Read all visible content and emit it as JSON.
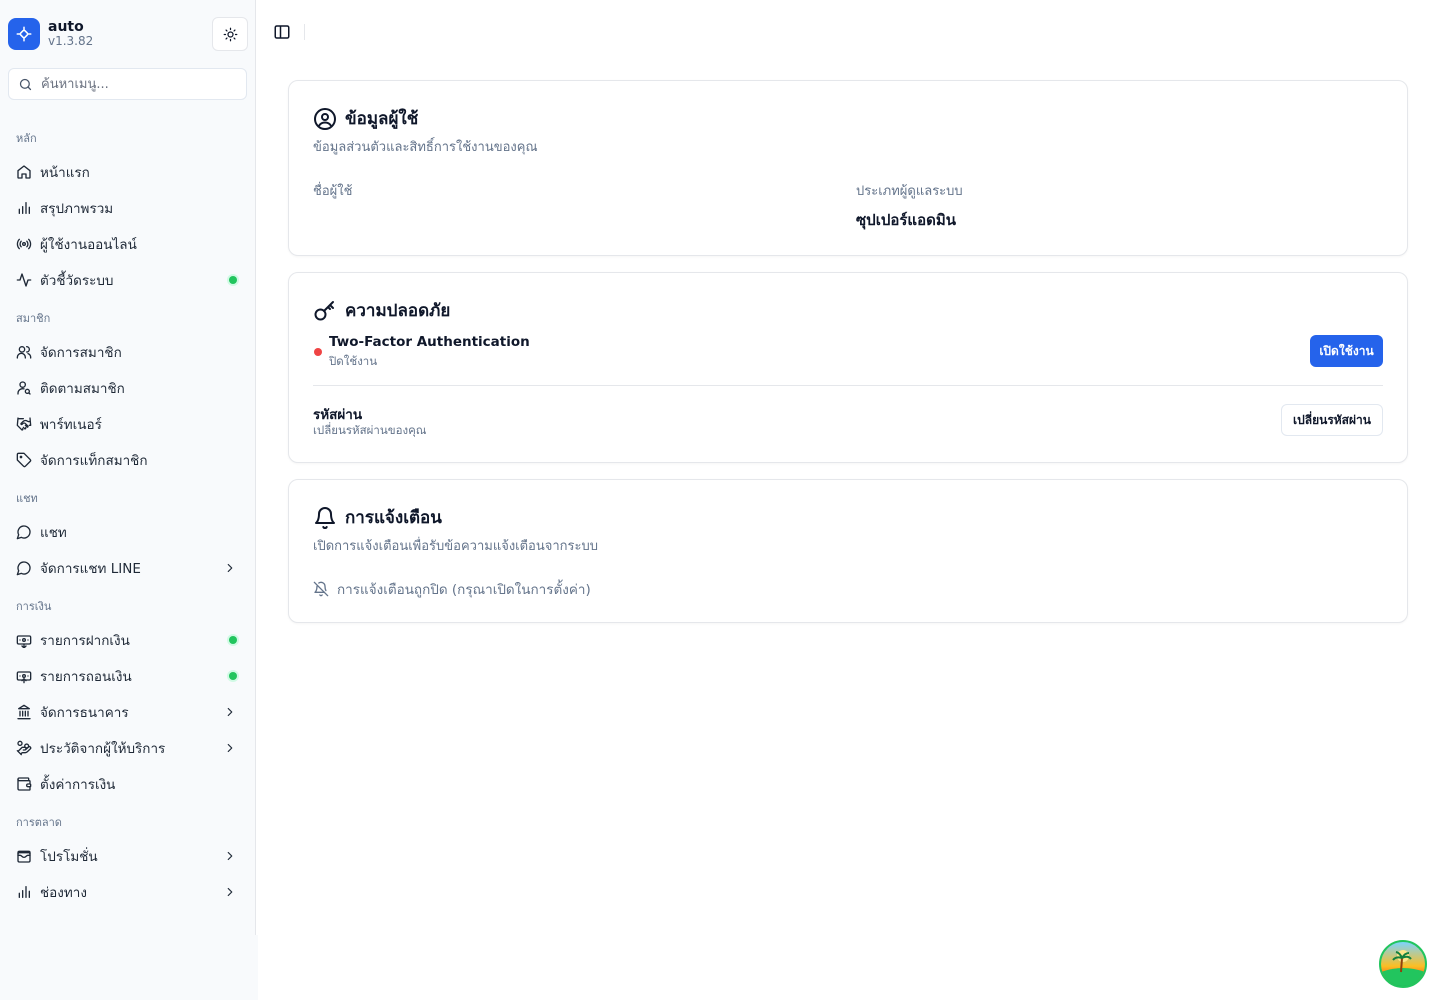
{
  "app": {
    "name": "auto",
    "version": "v1.3.82"
  },
  "search": {
    "placeholder": "ค้นหาเมนู..."
  },
  "sidebar": {
    "groups": [
      {
        "heading": "หลัก",
        "items": [
          {
            "label": "หน้าแรก",
            "icon": "home-icon"
          },
          {
            "label": "สรุปภาพรวม",
            "icon": "bar-chart-icon"
          },
          {
            "label": "ผู้ใช้งานออนไลน์",
            "icon": "broadcast-icon"
          },
          {
            "label": "ตัวชี้วัดระบบ",
            "icon": "activity-icon",
            "status": "online"
          }
        ]
      },
      {
        "heading": "สมาชิก",
        "items": [
          {
            "label": "จัดการสมาชิก",
            "icon": "users-icon"
          },
          {
            "label": "ติดตามสมาชิก",
            "icon": "user-search-icon"
          },
          {
            "label": "พาร์ทเนอร์",
            "icon": "handshake-icon"
          },
          {
            "label": "จัดการแท็กสมาชิก",
            "icon": "tag-icon"
          }
        ]
      },
      {
        "heading": "แชท",
        "items": [
          {
            "label": "แชท",
            "icon": "message-circle-icon"
          },
          {
            "label": "จัดการแชท LINE",
            "icon": "message-circle-icon",
            "expandable": true
          }
        ]
      },
      {
        "heading": "การเงิน",
        "items": [
          {
            "label": "รายการฝากเงิน",
            "icon": "deposit-icon",
            "status": "online"
          },
          {
            "label": "รายการถอนเงิน",
            "icon": "withdraw-icon",
            "status": "online"
          },
          {
            "label": "จัดการธนาคาร",
            "icon": "bank-icon",
            "expandable": true
          },
          {
            "label": "ประวัติจากผู้ให้บริการ",
            "icon": "hand-coins-icon",
            "expandable": true
          },
          {
            "label": "ตั้งค่าการเงิน",
            "icon": "wallet-icon"
          }
        ]
      },
      {
        "heading": "การตลาด",
        "items": [
          {
            "label": "โปรโมชั่น",
            "icon": "wallet-cards-icon",
            "expandable": true
          },
          {
            "label": "ช่องทาง",
            "icon": "bar-chart-icon",
            "expandable": true
          }
        ]
      }
    ]
  },
  "profile_card": {
    "title": "ข้อมูลผู้ใช้",
    "description": "ข้อมูลส่วนตัวและสิทธิ์การใช้งานของคุณ",
    "username_label": "ชื่อผู้ใช้",
    "username_value": "",
    "admin_type_label": "ประเภทผู้ดูแลระบบ",
    "admin_type_value": "ซุปเปอร์แอดมิน"
  },
  "security_card": {
    "title": "ความปลอดภัย",
    "two_factor": {
      "title": "Two-Factor Authentication",
      "status": "ปิดใช้งาน",
      "status_color": "#ef4444",
      "button": "เปิดใช้งาน"
    },
    "password": {
      "title": "รหัสผ่าน",
      "description": "เปลี่ยนรหัสผ่านของคุณ",
      "button": "เปลี่ยนรหัสผ่าน"
    }
  },
  "notification_card": {
    "title": "การแจ้งเตือน",
    "description": "เปิดการแจ้งเตือนเพื่อรับข้อความแจ้งเตือนจากระบบ",
    "status": "การแจ้งเตือนถูกปิด (กรุณาเปิดในการตั้งค่า)"
  },
  "colors": {
    "accent": "#2563eb",
    "online": "#22c55e",
    "danger": "#ef4444"
  }
}
